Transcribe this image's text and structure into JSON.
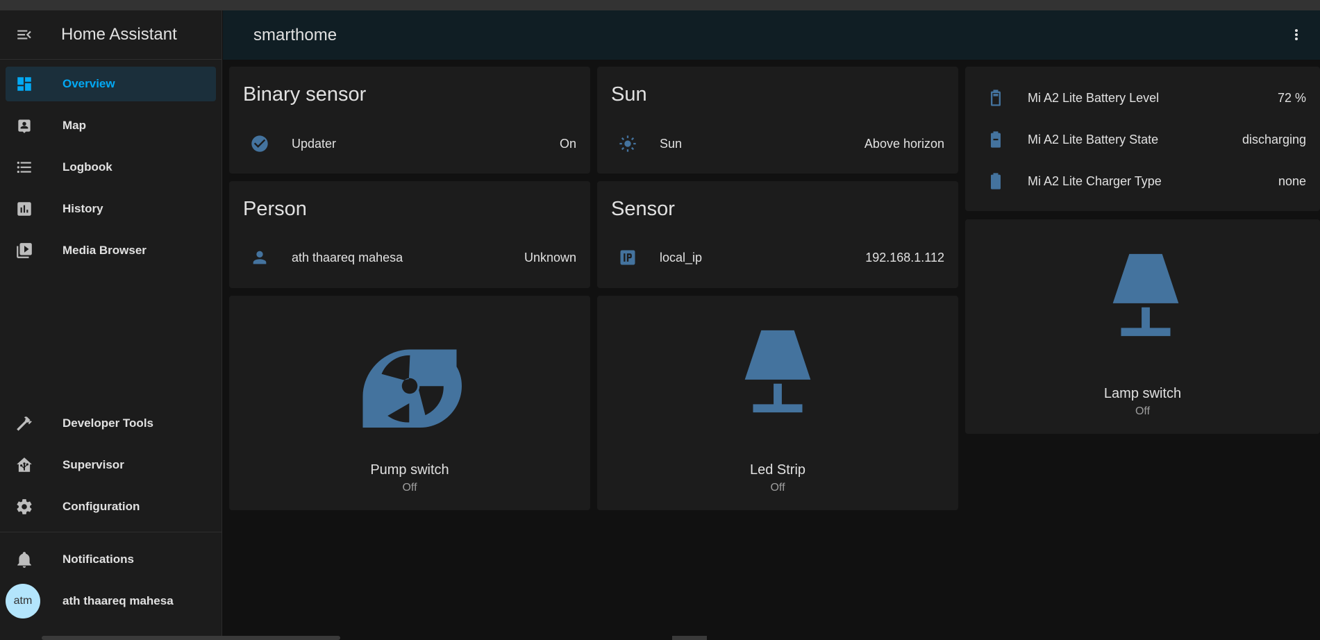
{
  "app": {
    "title": "Home Assistant"
  },
  "sidebar": {
    "items": [
      {
        "label": "Overview",
        "icon": "view-dashboard-icon",
        "active": true
      },
      {
        "label": "Map",
        "icon": "map-account-icon"
      },
      {
        "label": "Logbook",
        "icon": "logbook-icon"
      },
      {
        "label": "History",
        "icon": "chart-box-icon"
      },
      {
        "label": "Media Browser",
        "icon": "play-box-multiple-icon"
      }
    ],
    "bottom_items": [
      {
        "label": "Developer Tools",
        "icon": "hammer-icon"
      },
      {
        "label": "Supervisor",
        "icon": "home-assistant-icon"
      },
      {
        "label": "Configuration",
        "icon": "cog-icon"
      }
    ],
    "notifications_label": "Notifications",
    "user": {
      "initials": "atm",
      "name": "ath thaareq mahesa"
    }
  },
  "header": {
    "title": "smarthome"
  },
  "cards": {
    "binary_sensor": {
      "title": "Binary sensor",
      "rows": [
        {
          "name": "Updater",
          "value": "On",
          "icon": "check-circle-icon"
        }
      ]
    },
    "sun": {
      "title": "Sun",
      "rows": [
        {
          "name": "Sun",
          "value": "Above horizon",
          "icon": "sun-icon"
        }
      ]
    },
    "person": {
      "title": "Person",
      "rows": [
        {
          "name": "ath thaareq mahesa",
          "value": "Unknown",
          "icon": "account-icon"
        }
      ]
    },
    "sensor": {
      "title": "Sensor",
      "rows": [
        {
          "name": "local_ip",
          "value": "192.168.1.112",
          "icon": "ip-icon"
        }
      ]
    },
    "battery": {
      "rows": [
        {
          "name": "Mi A2 Lite Battery Level",
          "value": "72 %",
          "icon": "battery-icon"
        },
        {
          "name": "Mi A2 Lite Battery State",
          "value": "discharging",
          "icon": "battery-minus-icon"
        },
        {
          "name": "Mi A2 Lite Charger Type",
          "value": "none",
          "icon": "battery-icon"
        }
      ]
    },
    "pump": {
      "name": "Pump switch",
      "state": "Off",
      "icon": "pump-icon"
    },
    "led": {
      "name": "Led Strip",
      "state": "Off",
      "icon": "lamp-icon"
    },
    "lamp": {
      "name": "Lamp switch",
      "state": "Off",
      "icon": "lamp-icon"
    }
  },
  "colors": {
    "accent": "#03a9f4",
    "icon": "#44739e",
    "card": "#1c1c1c",
    "background": "#111111"
  }
}
